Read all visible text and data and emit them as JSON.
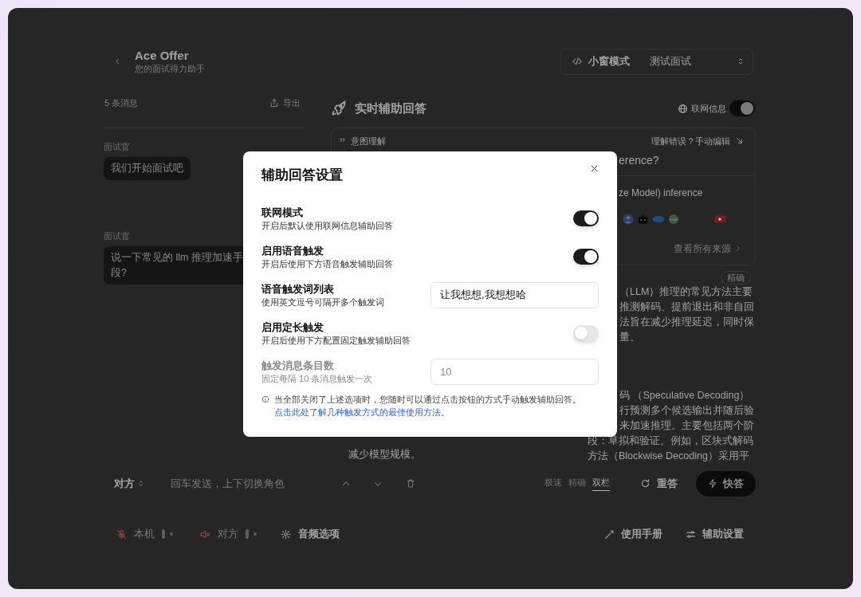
{
  "header": {
    "title": "Ace Offer",
    "subtitle": "您的面试得力助手",
    "mini_window": "小窗模式",
    "interview": "测试面试"
  },
  "messages_panel": {
    "count": "5 条消息",
    "export": "导出",
    "messages": [
      {
        "sender": "面试官",
        "lines": [
          "我们开始面试吧"
        ]
      },
      {
        "sender": "面试官",
        "lines": [
          "说一下常见的 llm 推理加速手",
          "段?"
        ]
      }
    ]
  },
  "assist_panel": {
    "title": "实时辅助回答",
    "web_info": {
      "label": "联网信息",
      "on": true
    },
    "intent": {
      "label": "意图理解",
      "edit_link": "理解错误？手动编辑",
      "question": "erence?",
      "query": "ze Model) inference",
      "all_sources": "查看所有来源"
    },
    "left_answer": {
      "lines": [
        "减少模型规模。"
      ]
    },
    "right_answer": {
      "badge": "精确",
      "paragraphs": [
        {
          "lines": [
            "（LLM）推理的常见方法主要",
            "推测解码、提前退出和非自回",
            "法旨在减少推理延迟，同时保",
            "量。"
          ]
        },
        {
          "lines": [
            "码 （Speculative Decoding）",
            "行预测多个候选输出并随后验",
            "来加速推理。主要包括两个阶",
            "段：草拟和验证。例如，区块式解码",
            "方法（Blockwise Decoding）采用平"
          ]
        }
      ]
    }
  },
  "input_bar": {
    "role": "对方",
    "placeholder": "回车发送，上下切换角色",
    "modes": [
      {
        "label": "极速",
        "selected": false
      },
      {
        "label": "精确",
        "selected": false
      },
      {
        "label": "双栏",
        "selected": true
      }
    ],
    "regenerate": "重答",
    "quick_answer": "快答"
  },
  "footer": {
    "audio": [
      {
        "kind": "mic",
        "label": "本机",
        "muted": true
      },
      {
        "kind": "speaker",
        "label": "对方",
        "muted": true
      }
    ],
    "audio_options": "音频选项",
    "manual": "使用手册",
    "assist_settings": "辅助设置"
  },
  "settings_dialog": {
    "title": "辅助回答设置",
    "items": [
      {
        "kind": "toggle",
        "label": "联网模式",
        "description": "开启后默认使用联网信息辅助回答",
        "on": true,
        "disabled": false
      },
      {
        "kind": "toggle",
        "label": "启用语音触发",
        "description": "开启后使用下方语音触发辅助回答",
        "on": true,
        "disabled": false
      },
      {
        "kind": "input",
        "label": "语音触发词列表",
        "description": "使用英文逗号可隔开多个触发词",
        "value": "让我想想,我想想哈",
        "disabled": false
      },
      {
        "kind": "toggle",
        "label": "启用定长触发",
        "description": "开启后使用下方配置固定触发辅助回答",
        "on": false,
        "disabled": false
      },
      {
        "kind": "input",
        "label": "触发消息条目数",
        "description": "固定每隔 10 条消息触发一次",
        "value": "10",
        "disabled": true
      }
    ],
    "note": "当全部关闭了上述选项时，您随时可以通过点击按钮的方式手动触发辅助回答。",
    "note_link": "点击此处了解几种触发方式的最佳使用方法。"
  }
}
